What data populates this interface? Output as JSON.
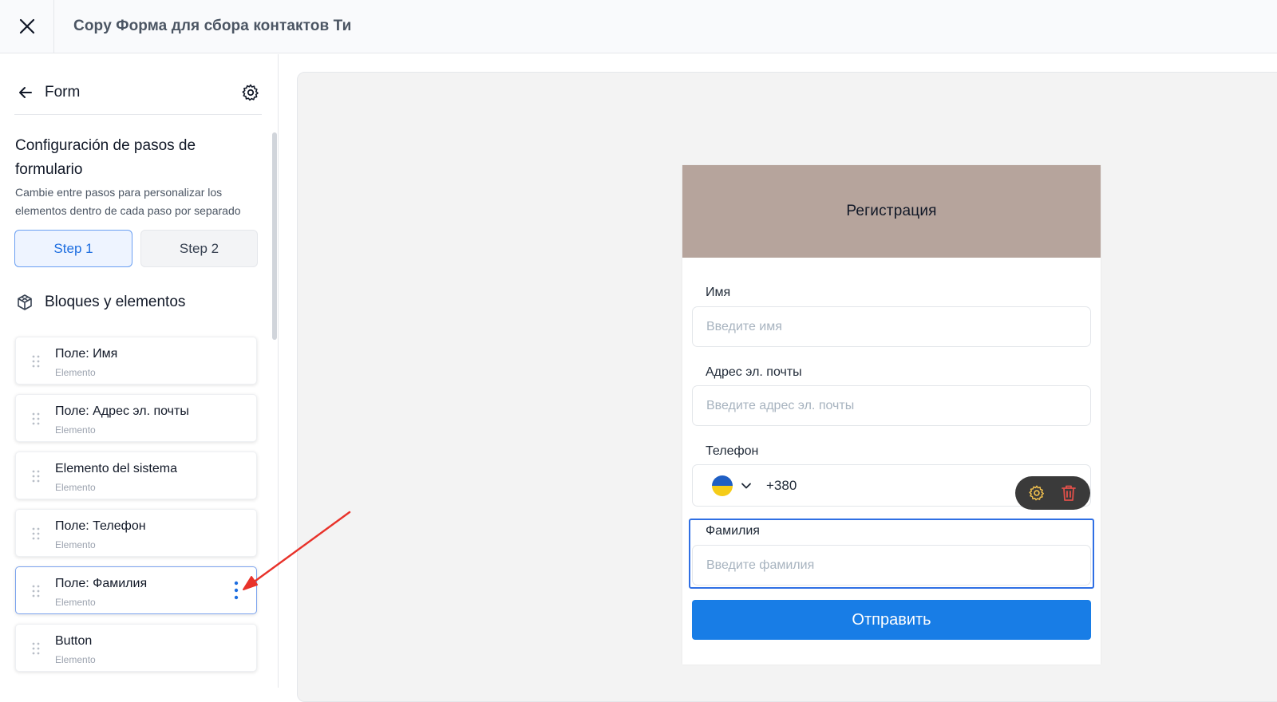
{
  "topbar": {
    "title": "Copy Форма для сбора контактов Ти",
    "close_icon": "close-icon"
  },
  "sidebar": {
    "header_title": "Form",
    "steps_title": "Configuración de pasos de formulario",
    "steps_description": "Cambie entre pasos para personalizar los elementos dentro de cada paso por separado",
    "steps": [
      {
        "label": "Step 1",
        "active": true
      },
      {
        "label": "Step 2",
        "active": false
      }
    ],
    "blocks_title": "Bloques y elementos",
    "elements": [
      {
        "name": "Поле: Имя",
        "type": "Elemento"
      },
      {
        "name": "Поле: Адрес эл. почты",
        "type": "Elemento"
      },
      {
        "name": "Elemento del sistema",
        "type": "Elemento"
      },
      {
        "name": "Поле: Телефон",
        "type": "Elemento"
      },
      {
        "name": "Поле: Фамилия",
        "type": "Elemento",
        "active": true
      },
      {
        "name": "Button",
        "type": "Elemento"
      }
    ]
  },
  "form": {
    "banner_title": "Регистрация",
    "banner_color": "#b6a49c",
    "fields": [
      {
        "label": "Имя",
        "placeholder": "Введите имя"
      },
      {
        "label": "Адрес эл. почты",
        "placeholder": "Введите адрес эл. почты"
      },
      {
        "label": "Телефон",
        "country_flag": "ukraine-flag-icon",
        "code": "+380"
      },
      {
        "label": "Фамилия",
        "placeholder": "Введите фамилия"
      }
    ],
    "submit_label": "Отправить",
    "submit_color": "#187de6"
  },
  "colors": {
    "accent": "#1d6ee0",
    "selection": "#2f6fe4",
    "annotation_arrow": "#e8322a",
    "toolbar_gear": "#f2c14e",
    "toolbar_trash": "#e2504a"
  }
}
